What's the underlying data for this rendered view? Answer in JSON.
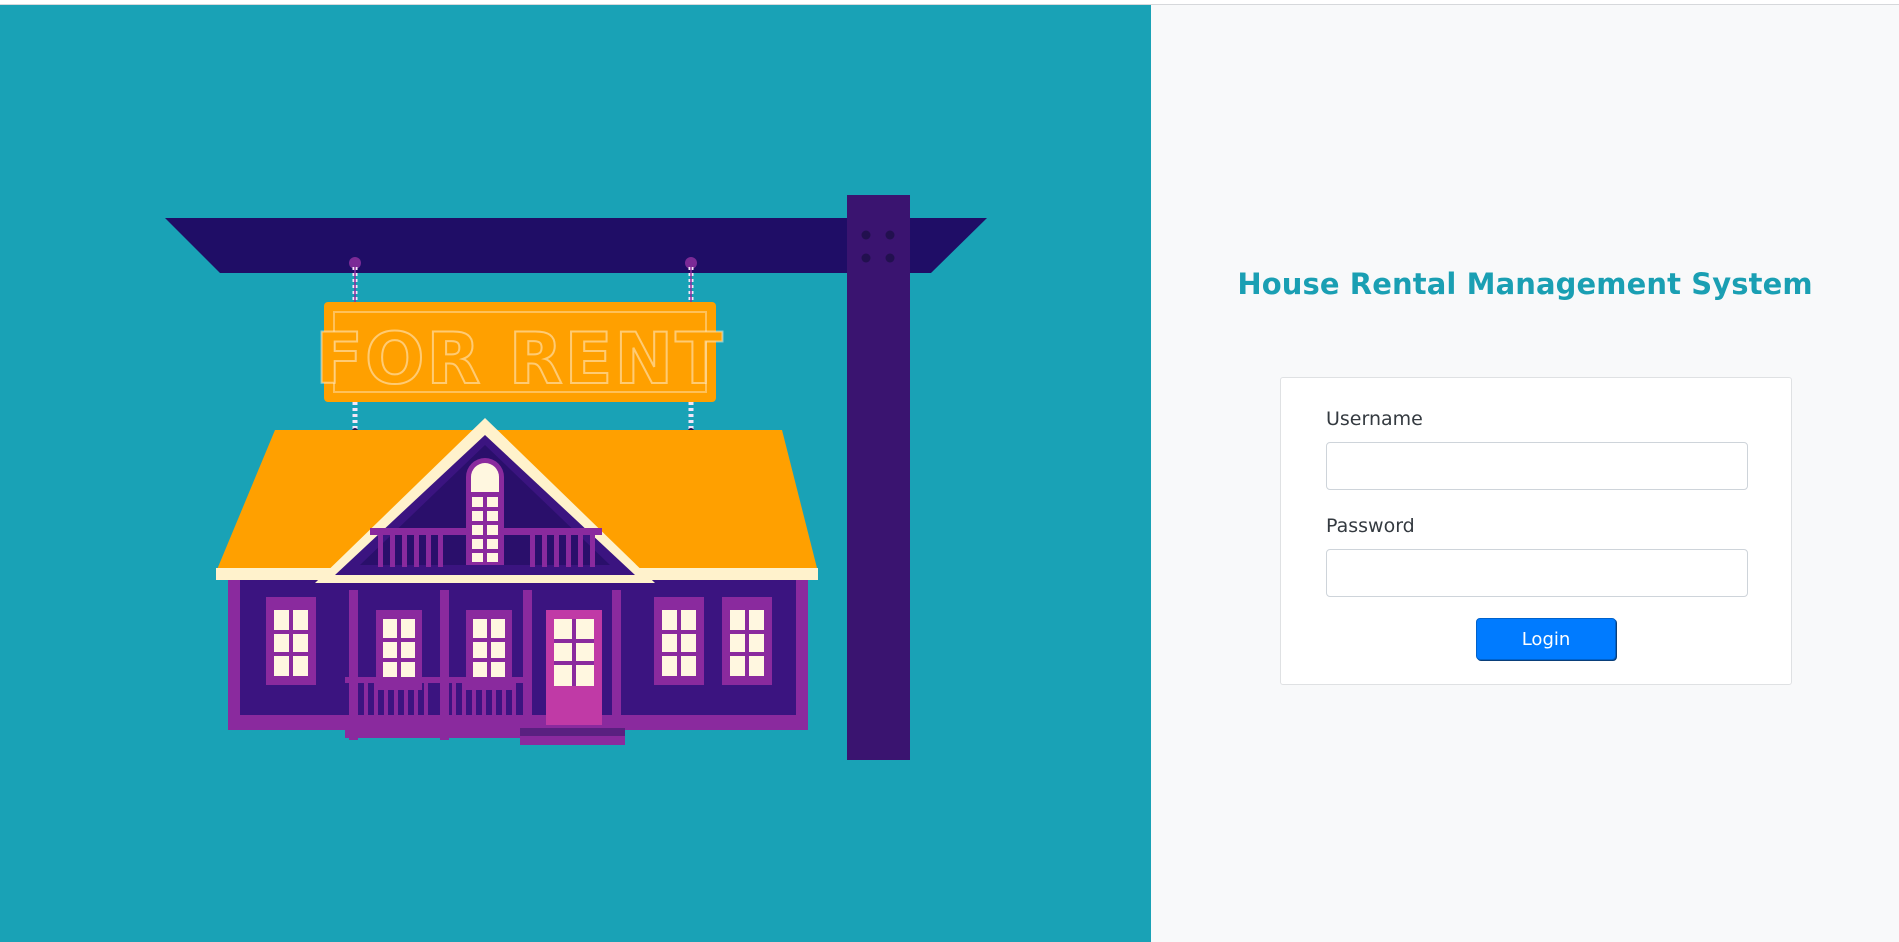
{
  "illustration": {
    "sign_text": "FOR RENT",
    "icon": "house-for-rent-illustration"
  },
  "colors": {
    "left_background": "#19a2b6",
    "right_background": "#f8f9fa",
    "title_color": "#1a9fb3",
    "button_color": "#007bff",
    "sign_orange": "#ffa000",
    "post_purple": "#3a1470"
  },
  "app": {
    "title": "House Rental Management System"
  },
  "login_form": {
    "username_label": "Username",
    "username_value": "",
    "password_label": "Password",
    "password_value": "",
    "login_button": "Login"
  }
}
